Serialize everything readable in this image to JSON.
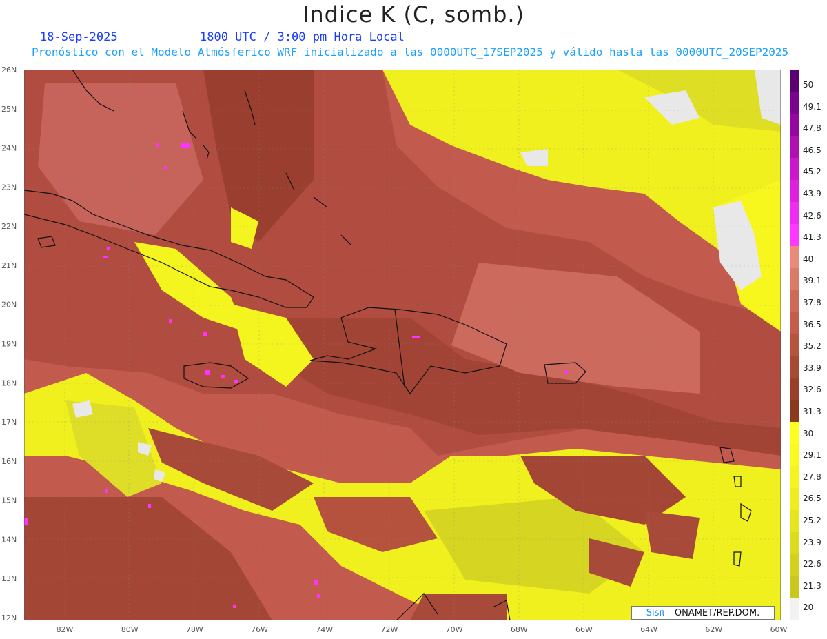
{
  "header": {
    "title": "Indice K (C, somb.)",
    "date": "18-Sep-2025",
    "time": "1800 UTC / 3:00 pm Hora Local",
    "forecast": "Pronóstico con el Modelo Atmósferico WRF inicializado a las 0000UTC_17SEP2025 y válido hasta las  0000UTC_20SEP2025"
  },
  "lat_labels": [
    "26N",
    "25N",
    "24N",
    "23N",
    "22N",
    "21N",
    "20N",
    "19N",
    "18N",
    "17N",
    "16N",
    "15N",
    "14N",
    "13N",
    "12N"
  ],
  "lon_labels": [
    "82W",
    "80W",
    "78W",
    "76W",
    "74W",
    "72W",
    "70W",
    "68W",
    "66W",
    "64W",
    "62W",
    "60W"
  ],
  "colorbar": {
    "labels": [
      "50",
      "49.1",
      "47.8",
      "46.5",
      "45.2",
      "43.9",
      "42.6",
      "41.3",
      "40",
      "39.1",
      "37.8",
      "36.5",
      "35.2",
      "33.9",
      "32.6",
      "31.3",
      "30",
      "29.1",
      "27.8",
      "26.5",
      "25.2",
      "23.9",
      "22.6",
      "21.3",
      "20"
    ],
    "colors": [
      "#f2f2f2",
      "#c8c81e",
      "#d2d21e",
      "#dcdc1e",
      "#e6e61e",
      "#eeee1e",
      "#f4f41e",
      "#fafa1e",
      "#ffff1e",
      "#8b3a1e",
      "#9a4028",
      "#a84a32",
      "#b7543e",
      "#c45e4a",
      "#d06a58",
      "#dc7a68",
      "#ea8a7a",
      "#ff38ff",
      "#f02cf0",
      "#e020e0",
      "#cc18cc",
      "#b010b0",
      "#9408a0",
      "#7a0490",
      "#5a0070"
    ]
  },
  "credit": {
    "sis": "Sisπ",
    "text": "– ONAMET/REP.DOM."
  }
}
